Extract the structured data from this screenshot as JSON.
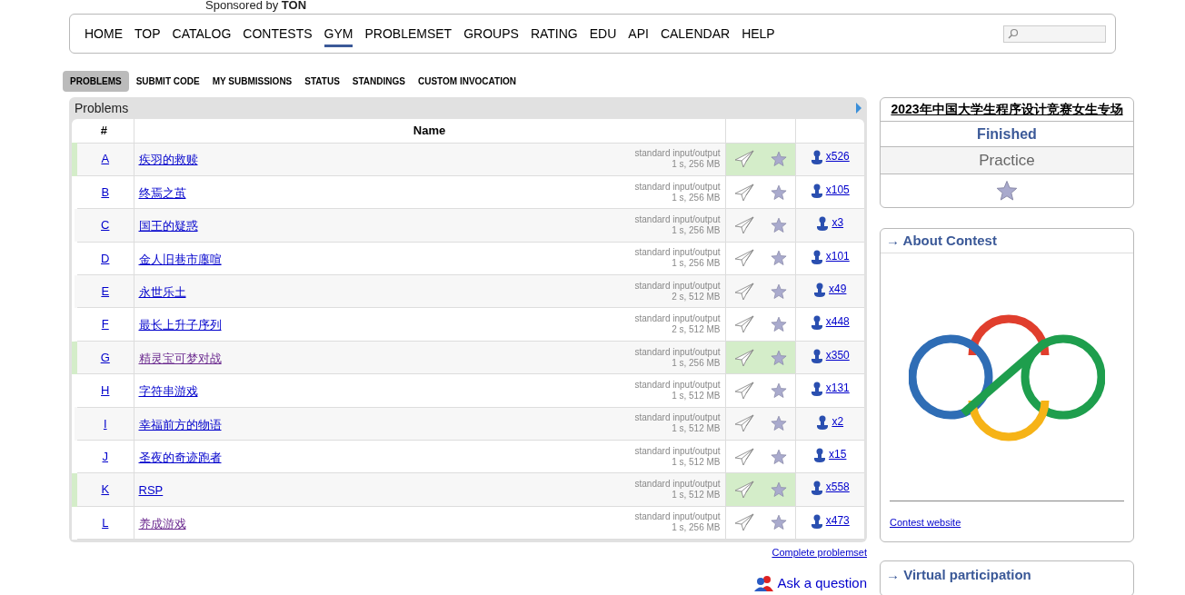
{
  "sponsor": {
    "text": "Sponsored by",
    "brand": "TON"
  },
  "menu": [
    {
      "label": "HOME",
      "selected": false
    },
    {
      "label": "TOP",
      "selected": false
    },
    {
      "label": "CATALOG",
      "selected": false
    },
    {
      "label": "CONTESTS",
      "selected": false
    },
    {
      "label": "GYM",
      "selected": true
    },
    {
      "label": "PROBLEMSET",
      "selected": false
    },
    {
      "label": "GROUPS",
      "selected": false
    },
    {
      "label": "RATING",
      "selected": false
    },
    {
      "label": "EDU",
      "selected": false
    },
    {
      "label": "API",
      "selected": false
    },
    {
      "label": "CALENDAR",
      "selected": false
    },
    {
      "label": "HELP",
      "selected": false
    }
  ],
  "tabs": [
    {
      "label": "PROBLEMS",
      "selected": true
    },
    {
      "label": "SUBMIT CODE",
      "selected": false
    },
    {
      "label": "MY SUBMISSIONS",
      "selected": false
    },
    {
      "label": "STATUS",
      "selected": false
    },
    {
      "label": "STANDINGS",
      "selected": false
    },
    {
      "label": "CUSTOM INVOCATION",
      "selected": false
    }
  ],
  "problems": {
    "title": "Problems",
    "columns": [
      "#",
      "Name"
    ],
    "rows": [
      {
        "index": "A",
        "name": "疾羽的救赎",
        "io": "standard input/output",
        "limits": "1 s, 256 MB",
        "solved_count": "x526",
        "accepted": true,
        "visited": false
      },
      {
        "index": "B",
        "name": "终焉之茧",
        "io": "standard input/output",
        "limits": "1 s, 256 MB",
        "solved_count": "x105",
        "accepted": false,
        "visited": false
      },
      {
        "index": "C",
        "name": "国王的疑惑",
        "io": "standard input/output",
        "limits": "1 s, 256 MB",
        "solved_count": "x3",
        "accepted": false,
        "visited": false
      },
      {
        "index": "D",
        "name": "金人旧巷市廛喧",
        "io": "standard input/output",
        "limits": "1 s, 256 MB",
        "solved_count": "x101",
        "accepted": false,
        "visited": false
      },
      {
        "index": "E",
        "name": "永世乐土",
        "io": "standard input/output",
        "limits": "2 s, 512 MB",
        "solved_count": "x49",
        "accepted": false,
        "visited": false
      },
      {
        "index": "F",
        "name": "最长上升子序列",
        "io": "standard input/output",
        "limits": "2 s, 512 MB",
        "solved_count": "x448",
        "accepted": false,
        "visited": false
      },
      {
        "index": "G",
        "name": "精灵宝可梦对战",
        "io": "standard input/output",
        "limits": "1 s, 256 MB",
        "solved_count": "x350",
        "accepted": true,
        "visited": true
      },
      {
        "index": "H",
        "name": "字符串游戏",
        "io": "standard input/output",
        "limits": "1 s, 512 MB",
        "solved_count": "x131",
        "accepted": false,
        "visited": false
      },
      {
        "index": "I",
        "name": "幸福前方的物语",
        "io": "standard input/output",
        "limits": "1 s, 512 MB",
        "solved_count": "x2",
        "accepted": false,
        "visited": false
      },
      {
        "index": "J",
        "name": "圣夜的奇迹跑者",
        "io": "standard input/output",
        "limits": "1 s, 512 MB",
        "solved_count": "x15",
        "accepted": false,
        "visited": false
      },
      {
        "index": "K",
        "name": "RSP",
        "io": "standard input/output",
        "limits": "1 s, 512 MB",
        "solved_count": "x558",
        "accepted": true,
        "visited": false
      },
      {
        "index": "L",
        "name": "养成游戏",
        "io": "standard input/output",
        "limits": "1 s, 256 MB",
        "solved_count": "x473",
        "accepted": false,
        "visited": true
      }
    ],
    "footer_link": "Complete problemset"
  },
  "ask_question": "Ask a question",
  "contest": {
    "title": "2023年中国大学生程序设计竞赛女生专场",
    "phase": "Finished",
    "type": "Practice"
  },
  "about": {
    "heading": "→ About Contest",
    "link": "Contest website"
  },
  "virtual": {
    "heading": "→ Virtual participation"
  }
}
